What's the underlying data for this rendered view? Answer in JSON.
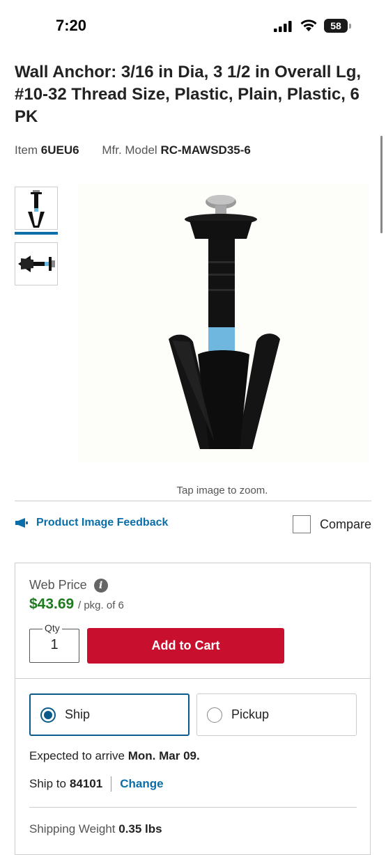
{
  "status_bar": {
    "time": "7:20",
    "battery": "58"
  },
  "product": {
    "title": "Wall Anchor: 3/16 in Dia, 3 1/2 in Overall Lg, #10-32 Thread Size, Plastic, Plain, Plastic, 6 PK",
    "item_label": "Item",
    "item_number": "6UEU6",
    "mfr_label": "Mfr. Model",
    "mfr_model": "RC-MAWSD35-6"
  },
  "gallery": {
    "thumbnails": [
      {
        "icon": "anchor-upright-thumbnail"
      },
      {
        "icon": "anchor-sideways-thumbnail"
      }
    ],
    "zoom_hint": "Tap image to zoom."
  },
  "actions": {
    "feedback_label": "Product Image Feedback",
    "compare_label": "Compare"
  },
  "pricing": {
    "web_price_label": "Web Price",
    "price": "$43.69",
    "per_unit": "/ pkg. of 6",
    "qty_label": "Qty",
    "qty_value": "1",
    "add_to_cart": "Add to Cart",
    "price_color": "#1f7a1f",
    "cart_color": "#c8102e"
  },
  "fulfillment": {
    "ship_label": "Ship",
    "pickup_label": "Pickup",
    "selected": "Ship",
    "arrive_text": "Expected to arrive",
    "arrive_date": "Mon. Mar 09.",
    "ship_to_label": "Ship to",
    "zip": "84101",
    "change_label": "Change",
    "weight_label": "Shipping Weight",
    "weight_value": "0.35 lbs"
  }
}
